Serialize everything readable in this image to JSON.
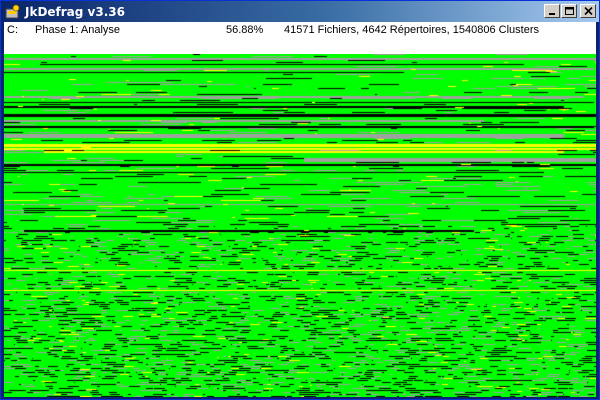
{
  "window": {
    "title": "JkDefrag v3.36",
    "buttons": {
      "minimize": "minimize",
      "maximize": "maximize",
      "close": "close"
    }
  },
  "status": {
    "drive": "C:",
    "phase": "Phase 1: Analyse",
    "percent": "56.88%",
    "info": "41571 Fichiers, 4642 Répertoires, 1540806 Clusters"
  },
  "disk_map": {
    "colors": {
      "used": "#00ff00",
      "free": "#a0a0a0",
      "fragmented": "#000000",
      "unmovable": "#ffff00",
      "background": "#ffffff"
    }
  }
}
